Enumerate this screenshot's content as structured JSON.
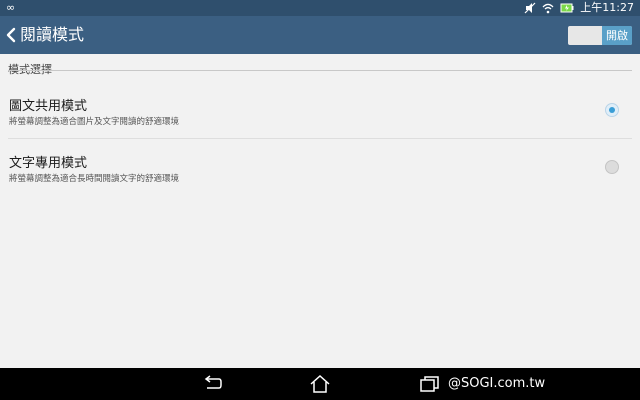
{
  "status_bar": {
    "left_icon": "∞",
    "time": "上午11:27"
  },
  "action_bar": {
    "title": "閱讀模式",
    "toggle_label": "開啟",
    "toggle_on": true
  },
  "section": {
    "header": "模式選擇"
  },
  "options": [
    {
      "title": "圖文共用模式",
      "subtitle": "將螢幕調整為適合圖片及文字閱讀的舒適環境",
      "selected": true
    },
    {
      "title": "文字專用模式",
      "subtitle": "將螢幕調整為適合長時間閱讀文字的舒適環境",
      "selected": false
    }
  ],
  "watermark": "@SOGI.com.tw",
  "icons": {
    "status": [
      "infinity-icon",
      "silent-icon",
      "wifi-icon",
      "battery-icon"
    ],
    "nav": [
      "back-icon",
      "home-icon",
      "recent-apps-icon"
    ]
  }
}
